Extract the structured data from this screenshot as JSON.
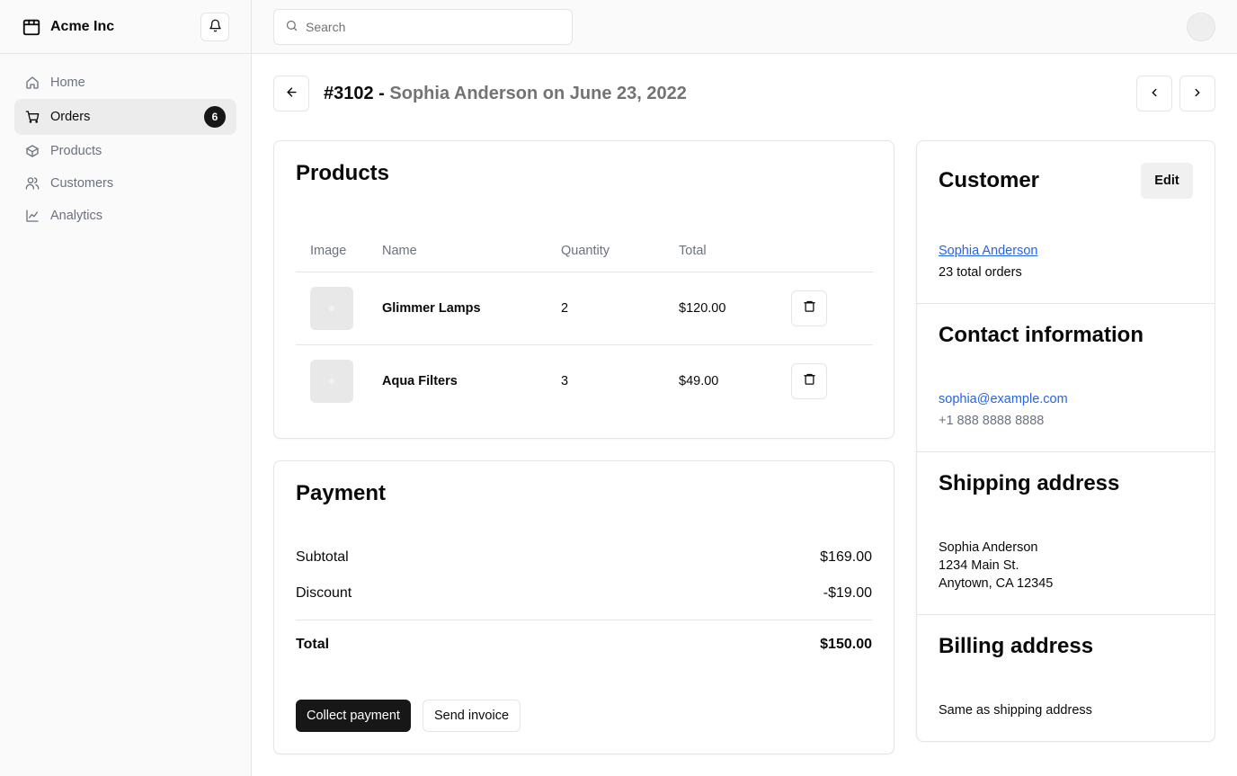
{
  "brand": {
    "name": "Acme Inc"
  },
  "sidebar": {
    "items": [
      {
        "label": "Home",
        "icon": "home-icon"
      },
      {
        "label": "Orders",
        "icon": "cart-icon",
        "badge": "6",
        "active": true
      },
      {
        "label": "Products",
        "icon": "package-icon"
      },
      {
        "label": "Customers",
        "icon": "users-icon"
      },
      {
        "label": "Analytics",
        "icon": "line-chart-icon"
      }
    ]
  },
  "topbar": {
    "search_placeholder": "Search"
  },
  "order": {
    "number": "#3102 -",
    "meta": "Sophia Anderson on June 23, 2022"
  },
  "products": {
    "title": "Products",
    "columns": [
      "Image",
      "Name",
      "Quantity",
      "Total"
    ],
    "rows": [
      {
        "name": "Glimmer Lamps",
        "quantity": "2",
        "total": "$120.00"
      },
      {
        "name": "Aqua Filters",
        "quantity": "3",
        "total": "$49.00"
      }
    ]
  },
  "payment": {
    "title": "Payment",
    "subtotal_label": "Subtotal",
    "subtotal_value": "$169.00",
    "discount_label": "Discount",
    "discount_value": "-$19.00",
    "total_label": "Total",
    "total_value": "$150.00",
    "collect_label": "Collect payment",
    "invoice_label": "Send invoice"
  },
  "customer": {
    "title": "Customer",
    "edit_label": "Edit",
    "name": "Sophia Anderson",
    "orders": "23 total orders"
  },
  "contact": {
    "title": "Contact information",
    "email": "sophia@example.com",
    "phone": "+1 888 8888 8888"
  },
  "shipping": {
    "title": "Shipping address",
    "line1": "Sophia Anderson",
    "line2": "1234 Main St.",
    "line3": "Anytown, CA 12345"
  },
  "billing": {
    "title": "Billing address",
    "text": "Same as shipping address"
  },
  "colors": {
    "accent": "#171717",
    "link": "#2563eb",
    "muted": "#6b7280"
  }
}
